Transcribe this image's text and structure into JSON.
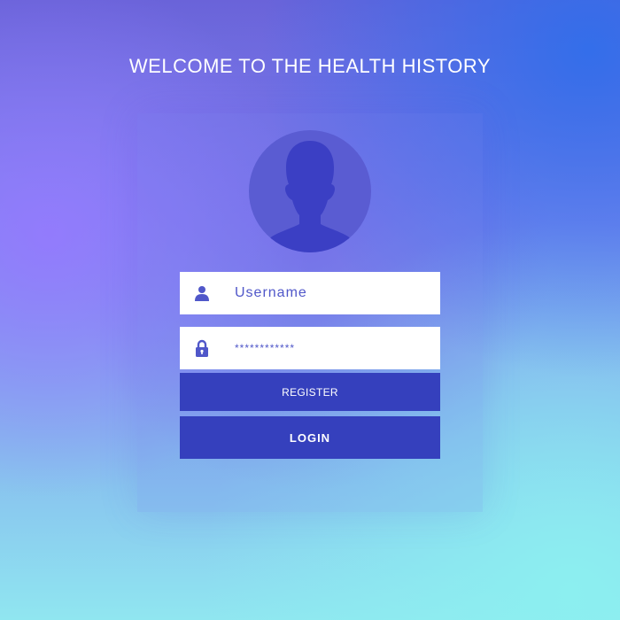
{
  "header": {
    "title": "WELCOME TO THE HEALTH HISTORY"
  },
  "avatar": {
    "icon": "user-silhouette-icon"
  },
  "form": {
    "username": {
      "icon": "user-icon",
      "placeholder": "Username"
    },
    "password": {
      "icon": "lock-icon",
      "value": "************"
    },
    "register_label": "REGISTER",
    "login_label": "LOGIN"
  },
  "colors": {
    "button_bg": "#3540bd",
    "accent_text": "#5057c9",
    "avatar_bg": "#5a5cd2",
    "silhouette": "#3b3fc4"
  }
}
